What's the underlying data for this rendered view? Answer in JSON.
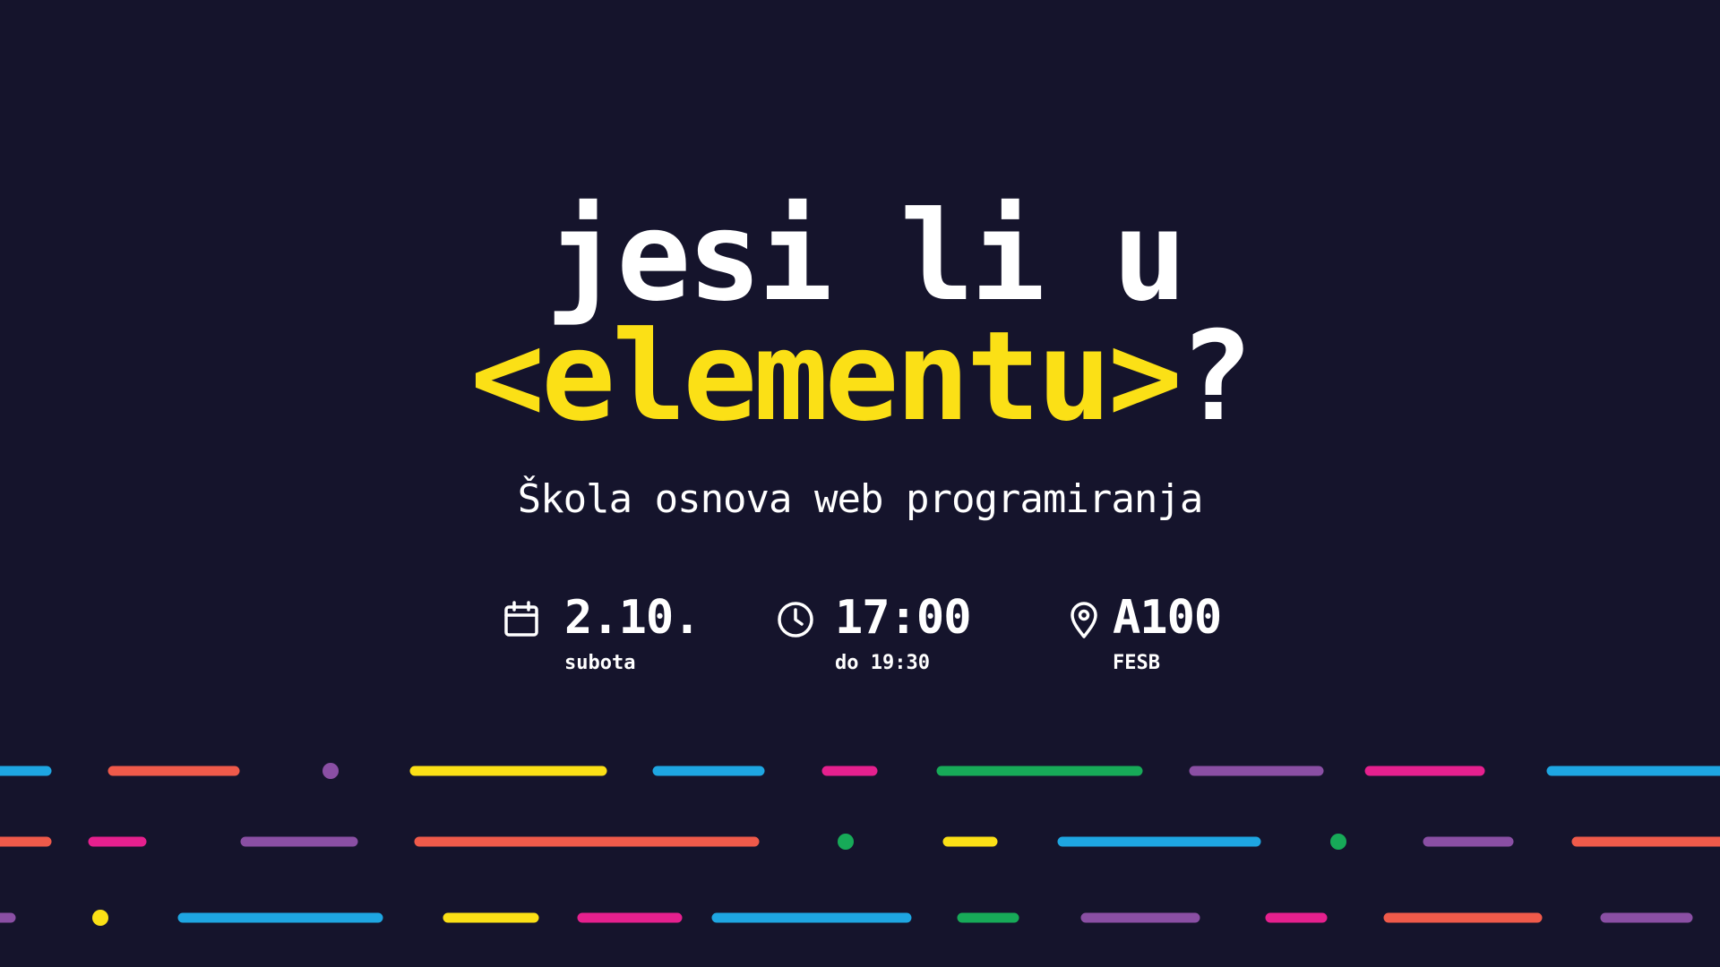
{
  "headline": {
    "line1": "jesi li u",
    "line2_accent": "<elementu>",
    "line2_end": "?"
  },
  "subtitle": "Škola osnova web programiranja",
  "info": {
    "date": {
      "icon": "calendar-icon",
      "value": "2.10.",
      "note": "subota"
    },
    "time": {
      "icon": "clock-icon",
      "value": "17:00",
      "note": "do 19:30"
    },
    "location": {
      "icon": "location-pin-icon",
      "value": "A100",
      "note": "FESB"
    }
  },
  "colors": {
    "background": "#15142c",
    "accent": "#fbe016",
    "text": "#ffffff",
    "blue": "#1ea6e2",
    "red": "#ef5a4a",
    "purple": "#8a4fa4",
    "yellow": "#fbe016",
    "pink": "#e5208e",
    "green": "#17aa58"
  }
}
